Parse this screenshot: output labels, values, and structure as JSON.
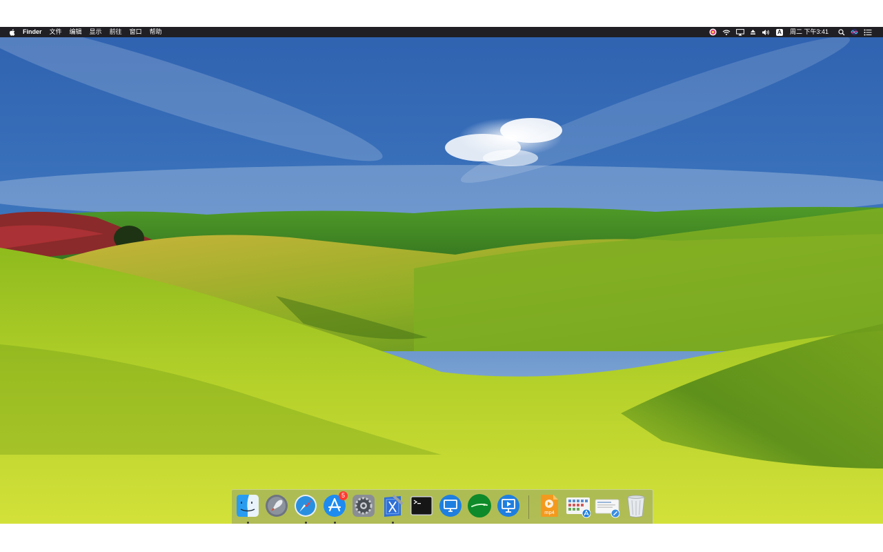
{
  "menubar": {
    "apple_icon": "apple-logo",
    "app_name": "Finder",
    "menus": [
      "文件",
      "编辑",
      "显示",
      "前往",
      "窗口",
      "帮助"
    ],
    "status_icons": [
      "flower-icon",
      "wifi-icon",
      "airplay-icon",
      "eject-icon",
      "volume-icon"
    ],
    "input_source": "A",
    "clock": "周二 下午3:41",
    "right_icons": [
      "search-icon",
      "siri-icon",
      "notification-center-icon"
    ]
  },
  "dock": {
    "apps": [
      {
        "name": "finder",
        "icon": "finder-icon",
        "running": true
      },
      {
        "name": "launchpad",
        "icon": "launchpad-icon",
        "running": false
      },
      {
        "name": "safari",
        "icon": "safari-icon",
        "running": true
      },
      {
        "name": "app-store",
        "icon": "app-store-icon",
        "running": true,
        "badge": "5"
      },
      {
        "name": "system-preferences",
        "icon": "gear-icon",
        "running": false
      },
      {
        "name": "xcode",
        "icon": "xcode-icon",
        "running": true
      },
      {
        "name": "terminal",
        "icon": "terminal-icon",
        "running": false
      },
      {
        "name": "remote-desktop",
        "icon": "monitor-icon",
        "running": false
      },
      {
        "name": "green-app",
        "icon": "green-circle-icon",
        "running": false
      },
      {
        "name": "screen-share",
        "icon": "presentation-icon",
        "running": false
      }
    ],
    "stacks": [
      {
        "name": "mp4-file",
        "icon": "mp4-file-icon",
        "label": "mp4"
      },
      {
        "name": "applications-stack",
        "icon": "applications-stack-icon"
      },
      {
        "name": "downloads-stack",
        "icon": "downloads-stack-icon"
      },
      {
        "name": "trash",
        "icon": "trash-icon"
      }
    ]
  },
  "colors": {
    "menubar_bg": "#1f1f24",
    "sky_top": "#2a5fa8",
    "grass": "#b6cf2a",
    "badge": "#ff3b30"
  }
}
